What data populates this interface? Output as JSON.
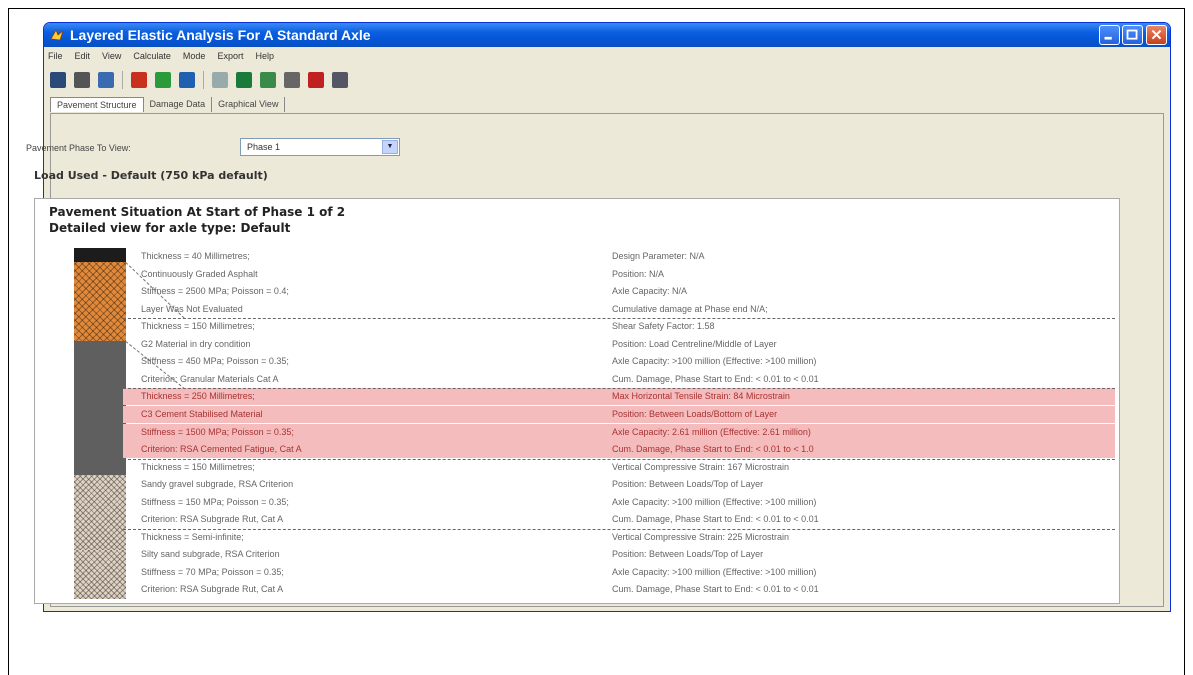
{
  "window": {
    "title": "Layered Elastic Analysis For A Standard Axle"
  },
  "menu": [
    "File",
    "Edit",
    "View",
    "Calculate",
    "Mode",
    "Export",
    "Help"
  ],
  "toolbar": {
    "icons": [
      "save-icon",
      "print-icon",
      "copy-icon",
      "flag-icon",
      "add-icon",
      "grid-icon",
      "document-icon",
      "chart-icon",
      "export-icon",
      "help-icon",
      "red-flag-icon",
      "exit-icon"
    ]
  },
  "tabs": [
    "Pavement Structure",
    "Damage Data",
    "Graphical View"
  ],
  "phase": {
    "label": "Pavement Phase To View:",
    "selected": "Phase 1"
  },
  "load_used": "Load Used - Default (750 kPa default)",
  "situation": {
    "title": "Pavement Situation At Start of Phase 1 of 2",
    "subtitle": "Detailed view for axle type: Default"
  },
  "rows": [
    {
      "left": "Thickness = 40 Millimetres;",
      "right": "Design Parameter: N/A"
    },
    {
      "left": "Continuously Graded Asphalt",
      "right": "Position: N/A"
    },
    {
      "left": "Stiffness = 2500 MPa; Poisson = 0.4;",
      "right": "Axle Capacity: N/A"
    },
    {
      "left": "Layer Was Not Evaluated",
      "right": "Cumulative damage at Phase end N/A;"
    },
    {
      "left": "Thickness = 150 Millimetres;",
      "right": "Shear Safety Factor: 1.58"
    },
    {
      "left": "G2 Material in dry condition",
      "right": "Position: Load Centreline/Middle of Layer"
    },
    {
      "left": "Stiffness = 450 MPa; Poisson = 0.35;",
      "right": "Axle Capacity: >100 million (Effective: >100 million)"
    },
    {
      "left": "Criterion: Granular Materials Cat A",
      "right": "Cum. Damage, Phase Start to End: < 0.01 to < 0.01"
    },
    {
      "left": "Thickness = 250 Millimetres;",
      "right": "Max Horizontal Tensile Strain: 84 Microstrain"
    },
    {
      "left": "C3 Cement Stabilised Material",
      "right": "Position: Between Loads/Bottom of Layer"
    },
    {
      "left": "Stiffness = 1500 MPa; Poisson = 0.35;",
      "right": "Axle Capacity: 2.61 million (Effective: 2.61 million)"
    },
    {
      "left": "Criterion: RSA Cemented Fatigue, Cat A",
      "right": "Cum. Damage, Phase Start to End: < 0.01 to < 1.0"
    },
    {
      "left": "Thickness = 150 Millimetres;",
      "right": "Vertical Compressive Strain: 167 Microstrain"
    },
    {
      "left": "Sandy gravel subgrade, RSA Criterion",
      "right": "Position: Between Loads/Top of Layer"
    },
    {
      "left": "Stiffness = 150 MPa; Poisson = 0.35;",
      "right": "Axle Capacity: >100 million (Effective: >100 million)"
    },
    {
      "left": "Criterion: RSA Subgrade Rut, Cat A",
      "right": "Cum. Damage, Phase Start to End: < 0.01 to < 0.01"
    },
    {
      "left": "Thickness = Semi-infinite;",
      "right": "Vertical Compressive Strain: 225 Microstrain"
    },
    {
      "left": "Silty sand subgrade, RSA Criterion",
      "right": "Position: Between Loads/Top of Layer"
    },
    {
      "left": "Stiffness = 70 MPa; Poisson = 0.35;",
      "right": "Axle Capacity: >100 million (Effective: >100 million)"
    },
    {
      "left": "Criterion: RSA Subgrade Rut, Cat A",
      "right": "Cum. Damage, Phase Start to End: < 0.01 to < 0.01"
    }
  ],
  "colors": {
    "highlight_row": "#f4bcbc",
    "asphalt": "#1c1c1c",
    "granular": "#e1893a",
    "cement": "#5f5f5f",
    "subgrade": "#dcd3c8"
  }
}
